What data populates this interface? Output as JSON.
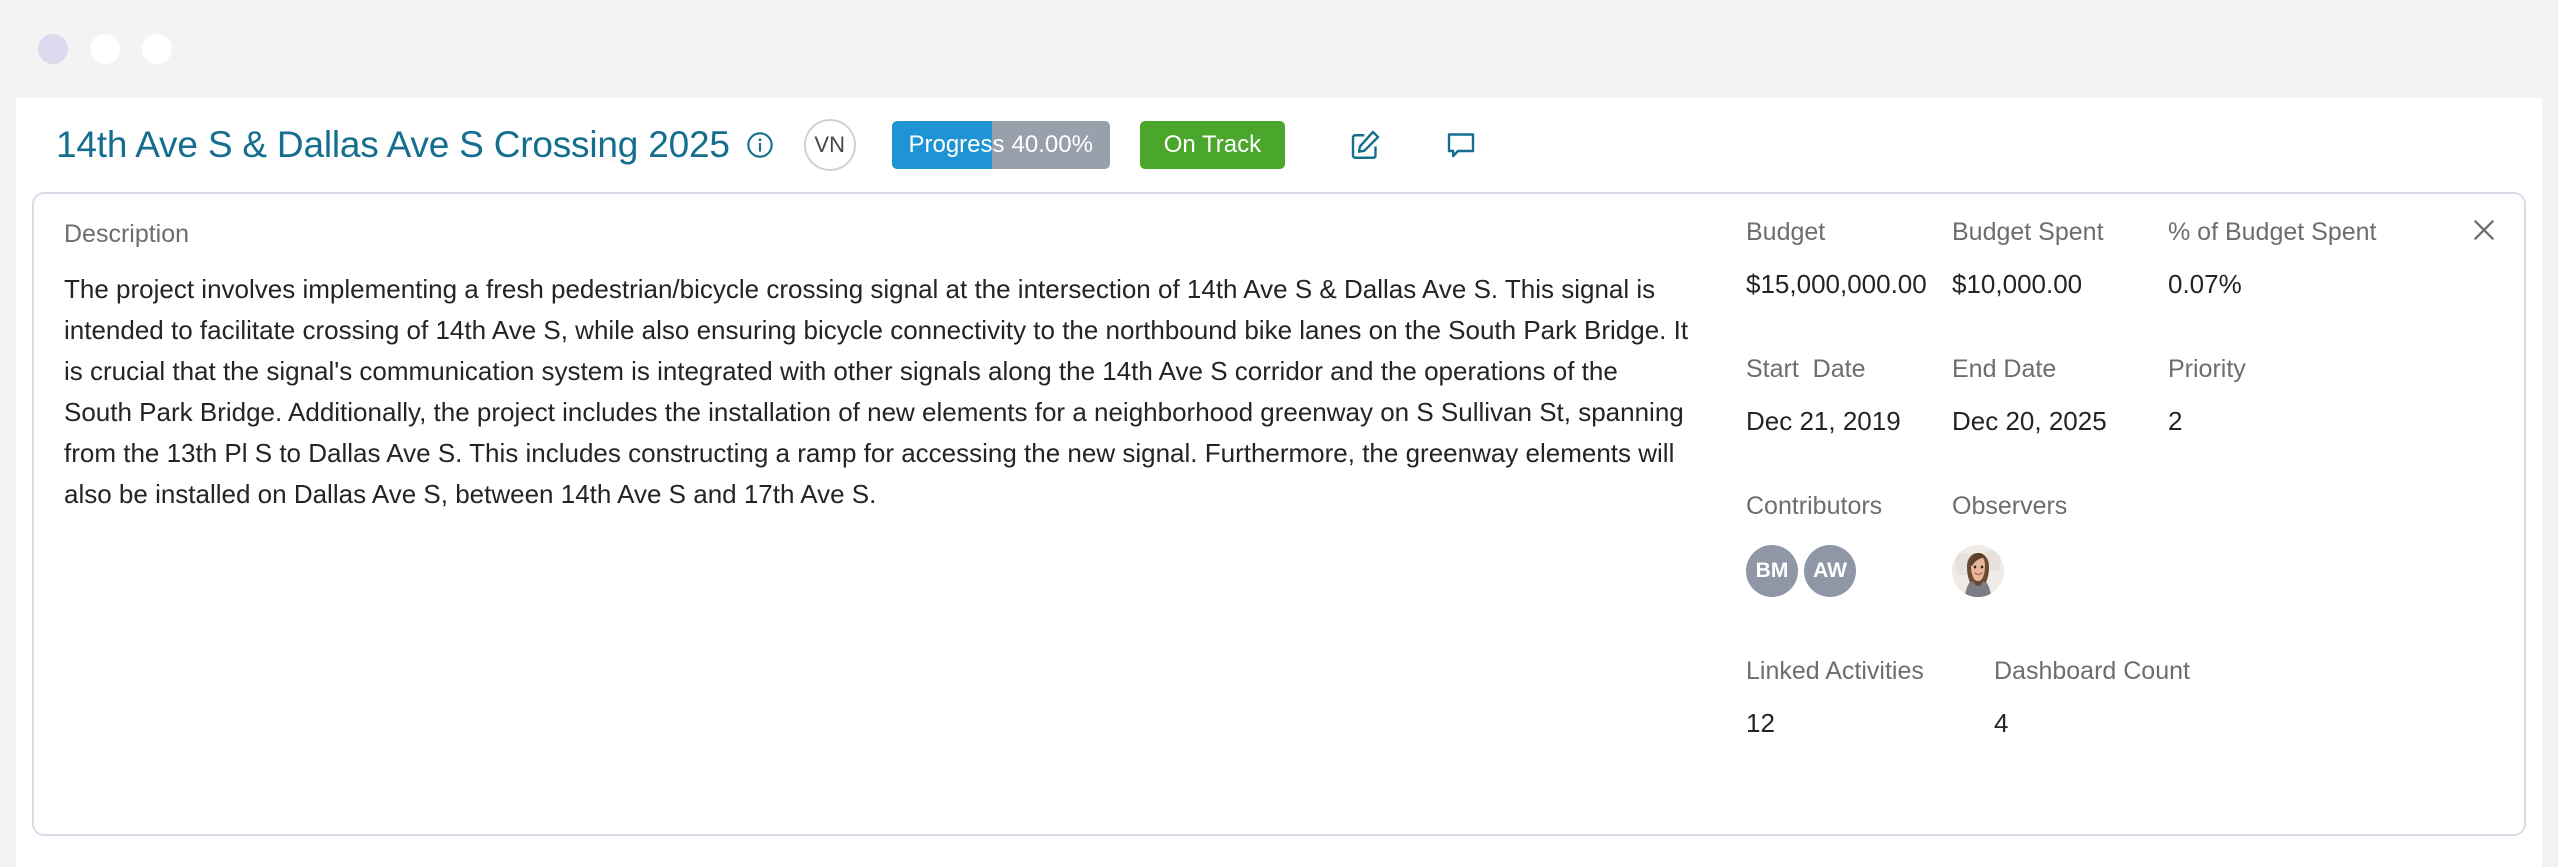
{
  "window": {
    "dots": [
      "purple-dot",
      "white-dot",
      "white-dot"
    ]
  },
  "header": {
    "title": "14th Ave S & Dallas Ave S Crossing 2025",
    "info_icon": "info-icon",
    "owner_initials": "VN",
    "progress": {
      "label": "Progress",
      "value_text": "40.00%",
      "percent": 40,
      "fill_color": "#1f94d4",
      "track_color": "#98a0ab"
    },
    "status": {
      "label": "On Track",
      "color": "#4ba72c"
    },
    "edit_icon": "edit-pencil-icon",
    "comment_icon": "comment-bubble-icon",
    "title_color": "#156e8e"
  },
  "card": {
    "close_label": "×",
    "border_color": "#dcdbea"
  },
  "description": {
    "label": "Description",
    "text": "The project involves implementing a fresh pedestrian/bicycle crossing signal at the intersection of 14th Ave S & Dallas Ave S. This signal is intended to facilitate crossing of 14th Ave S, while also ensuring bicycle connectivity to the northbound bike lanes on the South Park Bridge. It is crucial that the signal's communication system is integrated with other signals along the 14th Ave S corridor and the operations of the South Park Bridge. Additionally, the project includes the installation of new elements for a neighborhood greenway on S Sullivan St, spanning from the 13th Pl S to Dallas Ave S. This includes constructing a ramp for accessing the new signal. Furthermore, the greenway elements will also be installed on Dallas Ave S, between 14th Ave S and 17th Ave S."
  },
  "meta": {
    "budget": {
      "label": "Budget",
      "value": "$15,000,000.00"
    },
    "budget_spent": {
      "label": "Budget Spent",
      "value": "$10,000.00"
    },
    "pct_budget_spent": {
      "label": "% of Budget Spent",
      "value": "0.07%"
    },
    "start_date": {
      "label": "Start  Date",
      "value": "Dec 21, 2019"
    },
    "end_date": {
      "label": "End Date",
      "value": "Dec 20, 2025"
    },
    "priority": {
      "label": "Priority",
      "value": "2"
    },
    "contributors": {
      "label": "Contributors",
      "avatars": [
        {
          "initials": "BM"
        },
        {
          "initials": "AW"
        }
      ]
    },
    "observers": {
      "label": "Observers",
      "avatars": [
        {
          "type": "photo",
          "alt": "observer-profile-photo"
        }
      ]
    },
    "linked_activities": {
      "label": "Linked Activities",
      "value": "12"
    },
    "dashboard_count": {
      "label": "Dashboard Count",
      "value": "4"
    }
  }
}
